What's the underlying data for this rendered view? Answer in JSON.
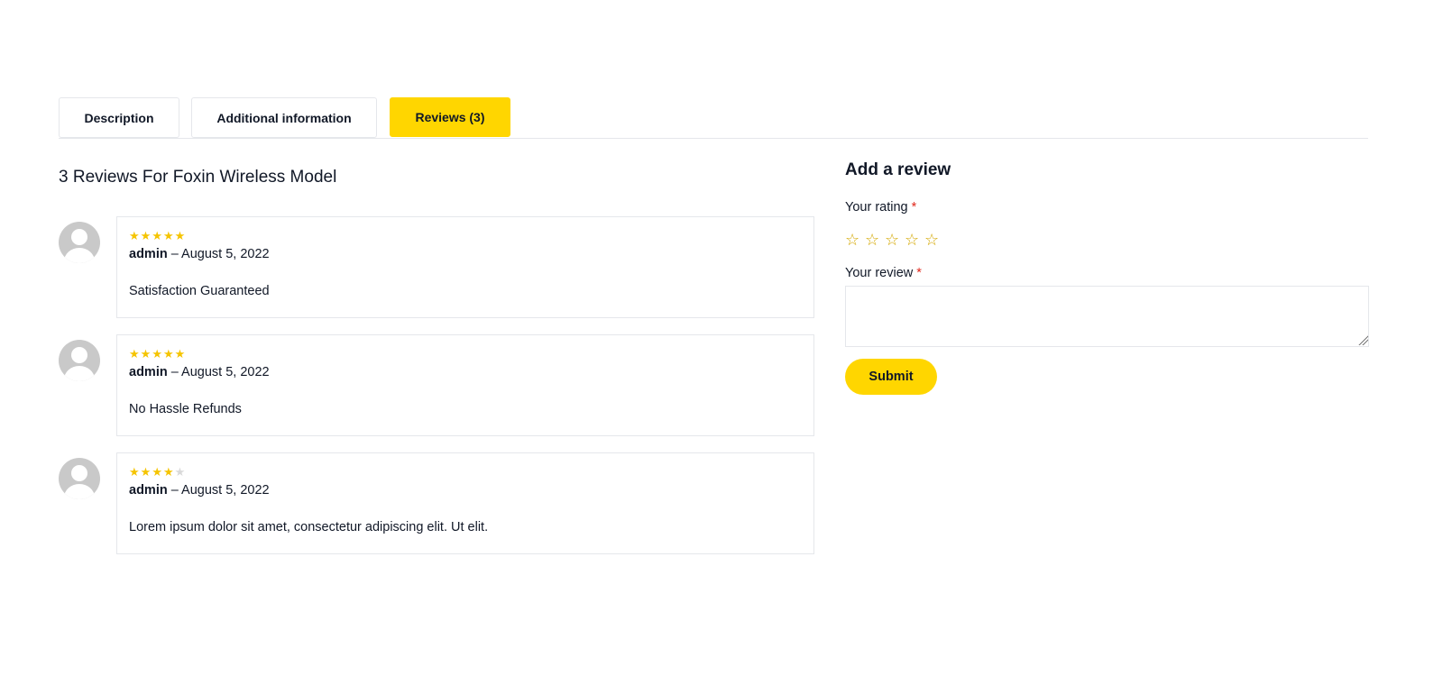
{
  "tabs": [
    {
      "label": "Description"
    },
    {
      "label": "Additional information"
    },
    {
      "label": "Reviews (3)"
    }
  ],
  "reviews_section": {
    "title": "3 Reviews For Foxin Wireless Model",
    "reviews": [
      {
        "rating": 5,
        "author": "admin",
        "date": " – August 5, 2022",
        "text": "Satisfaction Guaranteed"
      },
      {
        "rating": 5,
        "author": "admin",
        "date": " – August 5, 2022",
        "text": "No Hassle Refunds"
      },
      {
        "rating": 4,
        "author": "admin",
        "date": " – August 5, 2022",
        "text": "Lorem ipsum dolor sit amet, consectetur adipiscing elit. Ut elit."
      }
    ]
  },
  "add_review": {
    "title": "Add a review",
    "rating_label": "Your rating",
    "review_label": "Your review",
    "required_mark": "*",
    "submit_label": "Submit"
  },
  "colors": {
    "accent": "#ffd600",
    "star": "#f5c400",
    "required": "#e0281c"
  }
}
